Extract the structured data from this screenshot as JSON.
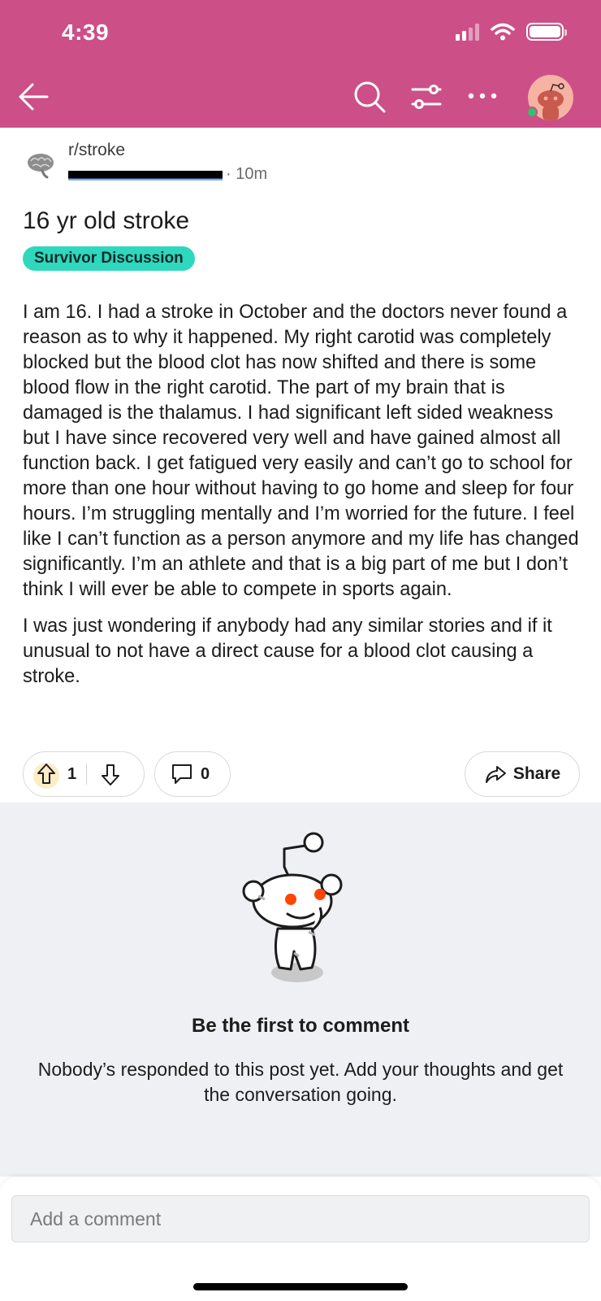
{
  "status_bar": {
    "time": "4:39"
  },
  "header": {
    "accent_color": "#cc4f88"
  },
  "post": {
    "subreddit": "r/stroke",
    "age": "· 10m",
    "title": "16 yr old stroke",
    "flair": "Survivor Discussion",
    "body": [
      "I am 16. I had a stroke in October and the doctors never found a reason as to why it happened. My right carotid was completely blocked but the blood clot has now shifted and there is some blood flow in the right carotid. The part of my brain that is damaged is the thalamus. I had significant left sided weakness but I have since recovered very well and have gained almost all function back. I get fatigued very easily and can’t go to school for more than one hour without having to go home and sleep for four hours. I’m struggling mentally and I’m worried for the future. I feel like I can’t function as a person anymore and my life has changed significantly. I’m an athlete and that is a big part of me but I don’t think I will ever be able to compete in sports again.",
      "I was just wondering if anybody had any similar stories and if it unusual to not have a direct cause for a blood clot causing a stroke."
    ],
    "upvotes": "1",
    "comments": "0",
    "share_label": "Share"
  },
  "empty_state": {
    "title": "Be the first to comment",
    "description": "Nobody’s responded to this post yet. Add your thoughts and get the conversation going."
  },
  "composer": {
    "placeholder": "Add a comment"
  },
  "icons": [
    "back-arrow-icon",
    "search-icon",
    "filter-icon",
    "more-icon",
    "avatar",
    "upvote-icon",
    "downvote-icon",
    "comment-icon",
    "share-icon",
    "snoo-illustration"
  ]
}
